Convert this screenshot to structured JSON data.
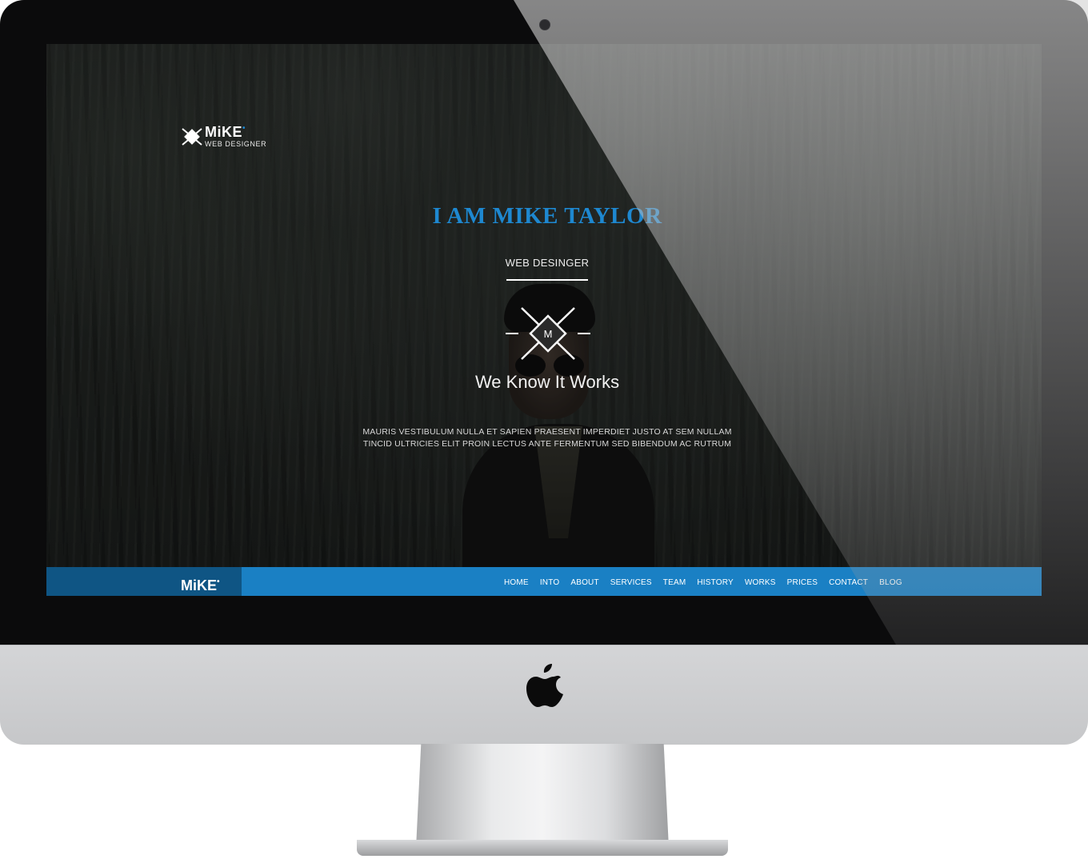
{
  "site": {
    "logo_name": "MiKE",
    "logo_tagline": "WEB DESIGNER",
    "hero_title": "I AM MIKE TAYLOR",
    "hero_subtitle": "WEB DESINGER",
    "emblem_letter": "M",
    "tagline": "We Know It Works",
    "paragraph_line1": "MAURIS VESTIBULUM NULLA ET SAPIEN PRAESENT IMPERDIET JUSTO AT SEM NULLAM",
    "paragraph_line2": "TINCID ULTRICIES ELIT PROIN LECTUS ANTE FERMENTUM SED BIBENDUM AC RUTRUM",
    "accent_color": "#1e88d0"
  },
  "navbar": {
    "brand": "MiKE",
    "items": [
      "HOME",
      "INTO",
      "ABOUT",
      "SERVICES",
      "TEAM",
      "HISTORY",
      "WORKS",
      "PRICES",
      "CONTACT",
      "BLOG"
    ],
    "bar_color": "#1a80c4",
    "brand_bg_color": "#0f5584"
  },
  "device": {
    "logo_icon": "apple-icon"
  }
}
